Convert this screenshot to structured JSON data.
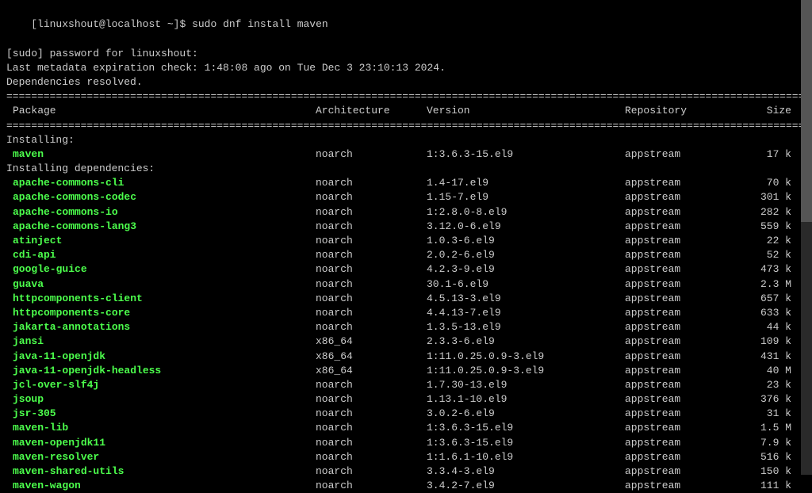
{
  "prompt": {
    "userhost": "[linuxshout@localhost ~]$",
    "command": "sudo dnf install maven",
    "sudo_prompt": "[sudo] password for linuxshout:",
    "metadata": "Last metadata expiration check: 1:48:08 ago on Tue Dec  3 23:10:13 2024.",
    "resolved": "Dependencies resolved."
  },
  "headers": {
    "package": "Package",
    "arch": "Architecture",
    "version": "Version",
    "repo": "Repository",
    "size": "Size"
  },
  "sections": {
    "installing": "Installing:",
    "installing_deps": "Installing dependencies:"
  },
  "main_package": {
    "name": "maven",
    "arch": "noarch",
    "version": "1:3.6.3-15.el9",
    "repo": "appstream",
    "size": "17 k"
  },
  "dependencies": [
    {
      "name": "apache-commons-cli",
      "arch": "noarch",
      "version": "1.4-17.el9",
      "repo": "appstream",
      "size": "70 k"
    },
    {
      "name": "apache-commons-codec",
      "arch": "noarch",
      "version": "1.15-7.el9",
      "repo": "appstream",
      "size": "301 k"
    },
    {
      "name": "apache-commons-io",
      "arch": "noarch",
      "version": "1:2.8.0-8.el9",
      "repo": "appstream",
      "size": "282 k"
    },
    {
      "name": "apache-commons-lang3",
      "arch": "noarch",
      "version": "3.12.0-6.el9",
      "repo": "appstream",
      "size": "559 k"
    },
    {
      "name": "atinject",
      "arch": "noarch",
      "version": "1.0.3-6.el9",
      "repo": "appstream",
      "size": "22 k"
    },
    {
      "name": "cdi-api",
      "arch": "noarch",
      "version": "2.0.2-6.el9",
      "repo": "appstream",
      "size": "52 k"
    },
    {
      "name": "google-guice",
      "arch": "noarch",
      "version": "4.2.3-9.el9",
      "repo": "appstream",
      "size": "473 k"
    },
    {
      "name": "guava",
      "arch": "noarch",
      "version": "30.1-6.el9",
      "repo": "appstream",
      "size": "2.3 M"
    },
    {
      "name": "httpcomponents-client",
      "arch": "noarch",
      "version": "4.5.13-3.el9",
      "repo": "appstream",
      "size": "657 k"
    },
    {
      "name": "httpcomponents-core",
      "arch": "noarch",
      "version": "4.4.13-7.el9",
      "repo": "appstream",
      "size": "633 k"
    },
    {
      "name": "jakarta-annotations",
      "arch": "noarch",
      "version": "1.3.5-13.el9",
      "repo": "appstream",
      "size": "44 k"
    },
    {
      "name": "jansi",
      "arch": "x86_64",
      "version": "2.3.3-6.el9",
      "repo": "appstream",
      "size": "109 k"
    },
    {
      "name": "java-11-openjdk",
      "arch": "x86_64",
      "version": "1:11.0.25.0.9-3.el9",
      "repo": "appstream",
      "size": "431 k"
    },
    {
      "name": "java-11-openjdk-headless",
      "arch": "x86_64",
      "version": "1:11.0.25.0.9-3.el9",
      "repo": "appstream",
      "size": "40 M"
    },
    {
      "name": "jcl-over-slf4j",
      "arch": "noarch",
      "version": "1.7.30-13.el9",
      "repo": "appstream",
      "size": "23 k"
    },
    {
      "name": "jsoup",
      "arch": "noarch",
      "version": "1.13.1-10.el9",
      "repo": "appstream",
      "size": "376 k"
    },
    {
      "name": "jsr-305",
      "arch": "noarch",
      "version": "3.0.2-6.el9",
      "repo": "appstream",
      "size": "31 k"
    },
    {
      "name": "maven-lib",
      "arch": "noarch",
      "version": "1:3.6.3-15.el9",
      "repo": "appstream",
      "size": "1.5 M"
    },
    {
      "name": "maven-openjdk11",
      "arch": "noarch",
      "version": "1:3.6.3-15.el9",
      "repo": "appstream",
      "size": "7.9 k"
    },
    {
      "name": "maven-resolver",
      "arch": "noarch",
      "version": "1:1.6.1-10.el9",
      "repo": "appstream",
      "size": "516 k"
    },
    {
      "name": "maven-shared-utils",
      "arch": "noarch",
      "version": "3.3.4-3.el9",
      "repo": "appstream",
      "size": "150 k"
    },
    {
      "name": "maven-wagon",
      "arch": "noarch",
      "version": "3.4.2-7.el9",
      "repo": "appstream",
      "size": "111 k"
    }
  ]
}
